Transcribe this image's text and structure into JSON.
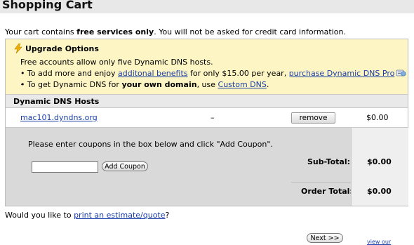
{
  "header": {
    "title": "Shopping Cart"
  },
  "intro": {
    "prefix": "Your cart contains ",
    "bold": "free services only",
    "suffix": ". You will not be asked for credit card information."
  },
  "upgrade": {
    "title": "Upgrade Options",
    "line1": "Free accounts allow only five Dynamic DNS hosts.",
    "line2_prefix": "• To add more and enjoy ",
    "line2_link": "additonal benefits",
    "line2_mid": " for only $15.00 per year, ",
    "line2_link2": "purchase Dynamic DNS Pro",
    "line2_suffix": ".",
    "line3_prefix": "• To get Dynamic DNS for ",
    "line3_bold": "your own domain",
    "line3_mid": ", use ",
    "line3_link": "Custom DNS",
    "line3_suffix": "."
  },
  "hosts": {
    "header": "Dynamic DNS Hosts",
    "rows": [
      {
        "name": "mac101.dyndns.org",
        "detail": "–",
        "action": "remove",
        "price": "$0.00"
      }
    ]
  },
  "coupon": {
    "instructions": "Please enter coupons in the box below and click \"Add Coupon\".",
    "input_value": "",
    "button": "Add Coupon"
  },
  "totals": {
    "subtotal_label": "Sub-Total:",
    "subtotal_value": "$0.00",
    "order_label": "Order Total:",
    "order_value": "$0.00"
  },
  "footer": {
    "estimate_prefix": "Would you like to ",
    "estimate_link": "print an estimate/quote",
    "estimate_suffix": "?",
    "next_button": "Next >>",
    "view_link": "view our"
  },
  "colors": {
    "upgrade_bg": "#fdf5c4",
    "coupon_bg": "#d9d9d9",
    "link": "#1a3fa8"
  },
  "icons": [
    "lightning-bolt-icon",
    "pro-badge-icon"
  ]
}
